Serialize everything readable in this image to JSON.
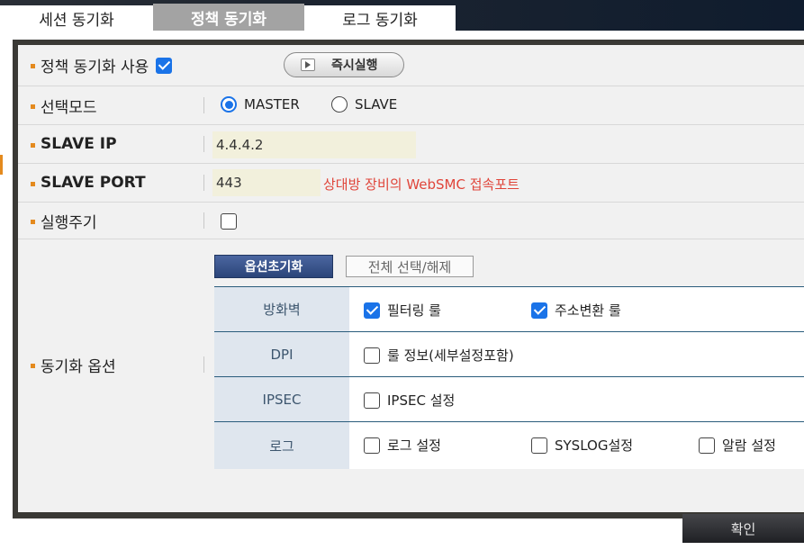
{
  "tabs": [
    {
      "label": "세션 동기화",
      "active": false
    },
    {
      "label": "정책 동기화",
      "active": true
    },
    {
      "label": "로그 동기화",
      "active": false
    }
  ],
  "form": {
    "enable": {
      "label": "정책 동기화 사용",
      "checked": true,
      "run_now_label": "즉시실행"
    },
    "mode": {
      "label": "선택모드",
      "options": [
        "MASTER",
        "SLAVE"
      ],
      "selected": "MASTER"
    },
    "slave_ip": {
      "label": "SLAVE IP",
      "value": "4.4.4.2"
    },
    "slave_port": {
      "label": "SLAVE PORT",
      "value": "443",
      "hint": "상대방 장비의 WebSMC 접속포트"
    },
    "period": {
      "label": "실행주기",
      "checked": false
    },
    "options": {
      "label": "동기화 옵션",
      "reset_label": "옵션초기화",
      "toggle_all_label": "전체 선택/해제",
      "rows": [
        {
          "head": "방화벽",
          "items": [
            {
              "label": "필터링 룰",
              "checked": true
            },
            {
              "label": "주소변환 룰",
              "checked": true
            }
          ]
        },
        {
          "head": "DPI",
          "items": [
            {
              "label": "룰 정보(세부설정포함)",
              "checked": false
            }
          ]
        },
        {
          "head": "IPSEC",
          "items": [
            {
              "label": "IPSEC 설정",
              "checked": false
            }
          ]
        },
        {
          "head": "로그",
          "items": [
            {
              "label": "로그 설정",
              "checked": false
            },
            {
              "label": "SYSLOG설정",
              "checked": false
            },
            {
              "label": "알람 설정",
              "checked": false
            }
          ]
        }
      ]
    }
  },
  "confirm_label": "확인",
  "colors": {
    "accent": "#e48a1e",
    "checkbox": "#1a73e8",
    "hint": "#e0453a",
    "reset_button": "#2b4579"
  }
}
